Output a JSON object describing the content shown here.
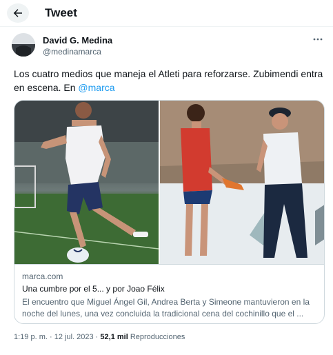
{
  "header": {
    "title": "Tweet",
    "back_icon": "arrow-left-icon"
  },
  "author": {
    "name": "David G. Medina",
    "handle": "@medinamarca"
  },
  "tweet": {
    "text": "Los cuatro medios que maneja el Atleti para reforzarse. Zubimendi entra en escena. En ",
    "mention": "@marca"
  },
  "card": {
    "domain": "marca.com",
    "title": "Una cumbre por el 5... y por Joao Félix",
    "description": "El encuentro que Miguel Ángel Gil, Andrea Berta y Simeone mantuvieron en la noche del lunes, una vez concluida la tradicional cena del cochinillo que el ..."
  },
  "meta": {
    "time": "1:19 p. m.",
    "separator": "·",
    "date": "12 jul. 2023",
    "views_count": "52,1 mil",
    "views_label": "Reproducciones"
  },
  "colors": {
    "accent": "#1d9bf0",
    "text": "#0f1419",
    "secondary": "#536471",
    "border": "#cfd9de"
  }
}
